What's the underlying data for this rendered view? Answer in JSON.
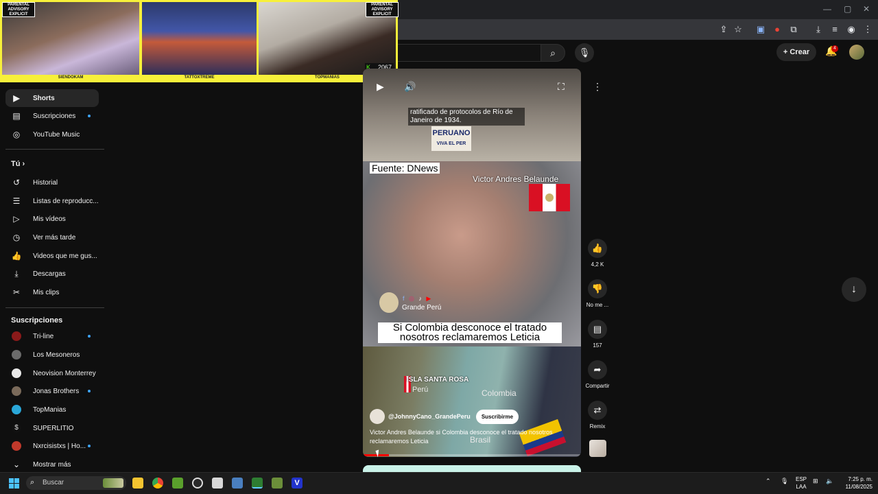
{
  "overlay": {
    "cams": [
      {
        "label": "SIENDOKAM"
      },
      {
        "label": "TATTOXTREME"
      },
      {
        "label": "TOPMANIAS"
      }
    ],
    "advisory": "PARENTAL ADVISORY EXPLICIT CONTENT",
    "kick_viewers": "2067"
  },
  "header": {
    "create_label": "Crear",
    "notifications_count": "4"
  },
  "sidebar": {
    "top_items": [
      {
        "label": "Shorts",
        "icon": "shorts-icon"
      },
      {
        "label": "Suscripciones",
        "icon": "subscriptions-icon"
      },
      {
        "label": "YouTube Music",
        "icon": "music-icon"
      }
    ],
    "you_heading": "Tú",
    "you_items": [
      {
        "label": "Historial",
        "icon": "history-icon"
      },
      {
        "label": "Listas de reproducc...",
        "icon": "playlist-icon"
      },
      {
        "label": "Mis vídeos",
        "icon": "my-videos-icon"
      },
      {
        "label": "Ver más tarde",
        "icon": "watch-later-icon"
      },
      {
        "label": "Videos que me gus...",
        "icon": "liked-icon"
      },
      {
        "label": "Descargas",
        "icon": "download-icon"
      },
      {
        "label": "Mis clips",
        "icon": "clips-icon"
      }
    ],
    "subs_heading": "Suscripciones",
    "subs": [
      {
        "label": "Tri-line",
        "color": "#8b1a1a"
      },
      {
        "label": "Los Mesoneros",
        "color": "#6b6b6b"
      },
      {
        "label": "Neovision Monterrey",
        "color": "#e8e8e8"
      },
      {
        "label": "Jonas Brothers",
        "color": "#7a6a5a"
      },
      {
        "label": "TopManias",
        "color": "#2aa7d8"
      },
      {
        "label": "SUPERLITIO",
        "color": "#111111"
      },
      {
        "label": "Nxrcisistxs | Ho...",
        "color": "#c0392b"
      }
    ],
    "show_more": "Mostrar más"
  },
  "video": {
    "caption_top": "ratificado de protocolos de Río de Janeiro de 1934.",
    "sign_text": "PERUANO",
    "sign_sub": "VIVA EL PER",
    "source": "Fuente: DNews",
    "person_name": "Victor Andres Belaunde",
    "brand": "Grande Perú",
    "headline": "Si Colombia desconoce el tratado nosotros reclamaremos Leticia",
    "map_island": "ISLA SANTA ROSA",
    "map_peru": "Perú",
    "map_colombia": "Colombia",
    "map_brasil": "Brasil",
    "channel": "@JohnnyCano_GrandePeru",
    "subscribe": "Suscribirme",
    "title": "Victor Andres Belaunde si Colombia desconoce el tratado nosotros reclamaremos Leticia",
    "progress": 0.12
  },
  "actions": {
    "likes": "4,2 K",
    "dislike": "No me ...",
    "comments": "157",
    "share": "Compartir",
    "remix": "Remix"
  },
  "taskbar": {
    "search_placeholder": "Buscar",
    "lang": "ESP",
    "lang_sub": "LAA",
    "time": "7:25 p. m.",
    "date": "11/08/2025"
  }
}
